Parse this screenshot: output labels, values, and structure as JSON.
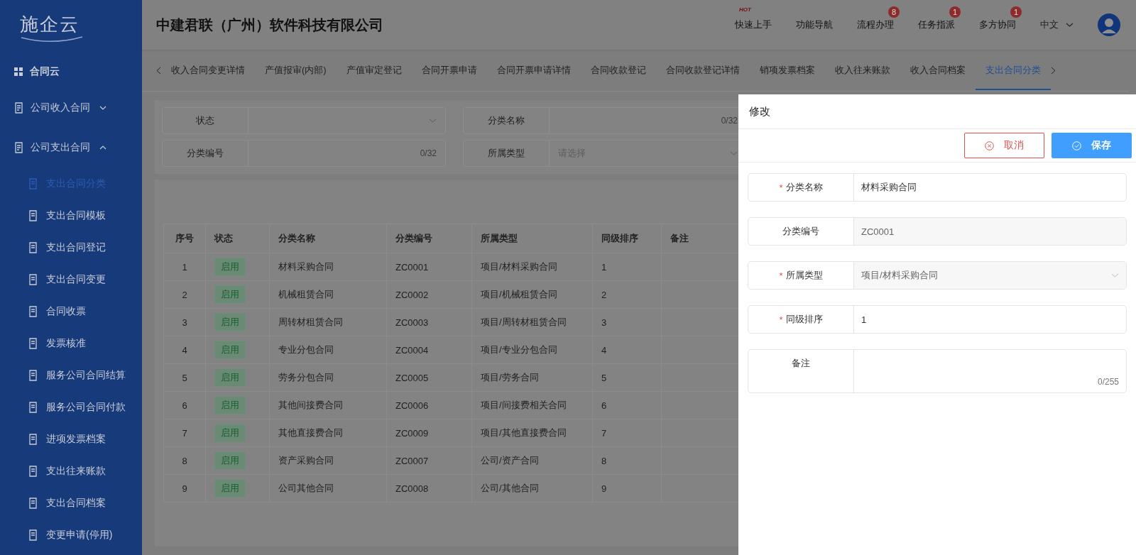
{
  "sidebar": {
    "logo": "施企云",
    "home": "合同云",
    "groups": [
      {
        "label": "公司收入合同",
        "expanded": false
      },
      {
        "label": "公司支出合同",
        "expanded": true,
        "children": [
          {
            "label": "支出合同分类",
            "selected": true
          },
          {
            "label": "支出合同模板",
            "selected": false
          },
          {
            "label": "支出合同登记",
            "selected": false
          },
          {
            "label": "支出合同变更",
            "selected": false
          },
          {
            "label": "合同收票",
            "selected": false
          },
          {
            "label": "发票核准",
            "selected": false
          },
          {
            "label": "服务公司合同结算",
            "selected": false
          },
          {
            "label": "服务公司合同付款",
            "selected": false
          },
          {
            "label": "进项发票档案",
            "selected": false
          },
          {
            "label": "支出往来账款",
            "selected": false
          },
          {
            "label": "支出合同档案",
            "selected": false
          },
          {
            "label": "变更申请(停用)",
            "selected": false
          }
        ]
      }
    ]
  },
  "header": {
    "company": "中建君联（广州）软件科技有限公司",
    "nav": [
      {
        "label": "快速上手",
        "hot": "HOT"
      },
      {
        "label": "功能导航"
      },
      {
        "label": "流程办理",
        "badge": "8"
      },
      {
        "label": "任务指派",
        "badge": "1"
      },
      {
        "label": "多方协同",
        "badge": "1"
      }
    ],
    "language": "中文"
  },
  "tabs": [
    {
      "label": "收入合同变更详情",
      "selected": false
    },
    {
      "label": "产值报审(内部)",
      "selected": false
    },
    {
      "label": "产值审定登记",
      "selected": false
    },
    {
      "label": "合同开票申请",
      "selected": false
    },
    {
      "label": "合同开票申请详情",
      "selected": false
    },
    {
      "label": "合同收款登记",
      "selected": false
    },
    {
      "label": "合同收款登记详情",
      "selected": false
    },
    {
      "label": "销项发票档案",
      "selected": false
    },
    {
      "label": "收入往来账款",
      "selected": false
    },
    {
      "label": "收入合同档案",
      "selected": false
    },
    {
      "label": "支出合同分类",
      "selected": true
    }
  ],
  "filters": [
    {
      "label": "状态",
      "kind": "select"
    },
    {
      "label": "分类名称",
      "kind": "input",
      "counter": "0/32"
    },
    {
      "label": "分类编号",
      "kind": "input",
      "counter": "0/32"
    },
    {
      "label": "所属类型",
      "kind": "select",
      "placeholder": "请选择"
    }
  ],
  "table": {
    "columns": [
      "序号",
      "状态",
      "分类名称",
      "分类编号",
      "所属类型",
      "同级排序",
      "备注"
    ],
    "rows": [
      [
        "1",
        "启用",
        "材料采购合同",
        "ZC0001",
        "项目/材料采购合同",
        "1"
      ],
      [
        "2",
        "启用",
        "机械租赁合同",
        "ZC0002",
        "项目/机械租赁合同",
        "2"
      ],
      [
        "3",
        "启用",
        "周转材租赁合同",
        "ZC0003",
        "项目/周转材租赁合同",
        "3"
      ],
      [
        "4",
        "启用",
        "专业分包合同",
        "ZC0004",
        "项目/专业分包合同",
        "4"
      ],
      [
        "5",
        "启用",
        "劳务分包合同",
        "ZC0005",
        "项目/劳务合同",
        "5"
      ],
      [
        "6",
        "启用",
        "其他间接费合同",
        "ZC0006",
        "项目/间接费相关合同",
        "6"
      ],
      [
        "7",
        "启用",
        "其他直接费合同",
        "ZC0009",
        "项目/其他直接费合同",
        "7"
      ],
      [
        "8",
        "启用",
        "资产采购合同",
        "ZC0007",
        "公司/资产合同",
        "8"
      ],
      [
        "9",
        "启用",
        "公司其他合同",
        "ZC0008",
        "公司/其他合同",
        "9"
      ]
    ]
  },
  "drawer": {
    "title": "修改",
    "cancel": "取消",
    "save": "保存",
    "fields": [
      {
        "label": "分类名称",
        "required_mark": "*",
        "kind": "input",
        "value": "材料采购合同"
      },
      {
        "label": "分类编号",
        "kind": "readonly",
        "value": "ZC0001"
      },
      {
        "label": "所属类型",
        "required_mark": "*",
        "kind": "select",
        "value": "项目/材料采购合同"
      },
      {
        "label": "同级排序",
        "required_mark": "*",
        "kind": "input",
        "value": "1"
      },
      {
        "label": "备注",
        "kind": "textarea",
        "counter": "0/255"
      }
    ]
  }
}
